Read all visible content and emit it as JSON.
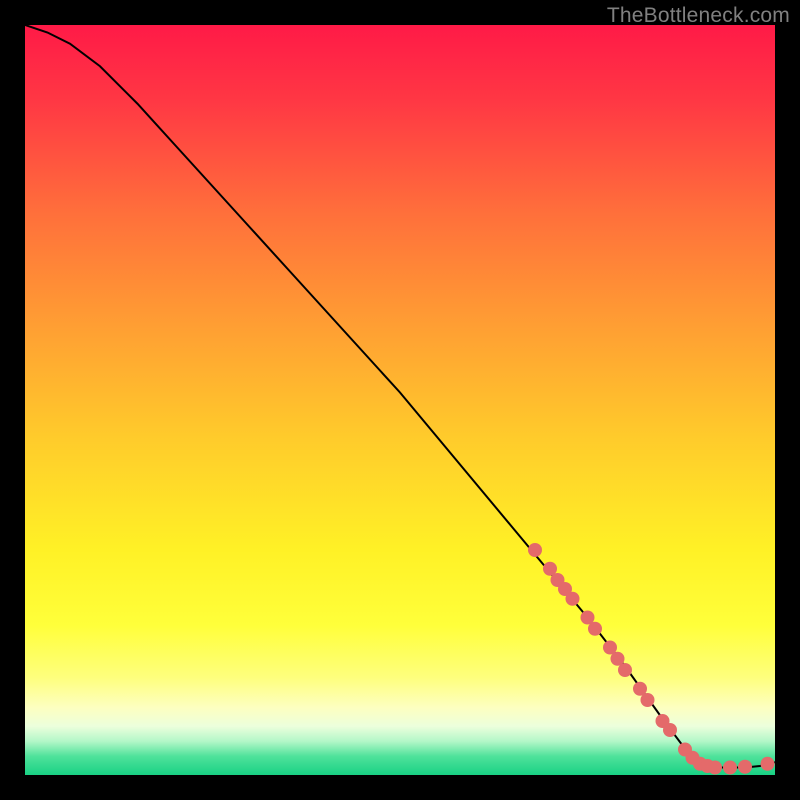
{
  "watermark": "TheBottleneck.com",
  "chart_data": {
    "type": "line",
    "title": "",
    "xlabel": "",
    "ylabel": "",
    "xlim": [
      0,
      100
    ],
    "ylim": [
      0,
      100
    ],
    "series": [
      {
        "name": "curve",
        "x": [
          0,
          3,
          6,
          10,
          15,
          20,
          25,
          30,
          35,
          40,
          45,
          50,
          55,
          60,
          65,
          70,
          75,
          80,
          85,
          88,
          90,
          92,
          94,
          96,
          98,
          100
        ],
        "y": [
          100,
          99,
          97.5,
          94.5,
          89.5,
          84,
          78.5,
          73,
          67.5,
          62,
          56.5,
          51,
          45,
          39,
          33,
          27,
          21,
          14.5,
          7.5,
          3.5,
          1.5,
          1,
          1,
          1,
          1.2,
          1.7
        ]
      }
    ],
    "scatter_points": {
      "name": "highlight-dots",
      "x": [
        68,
        70,
        71,
        72,
        73,
        75,
        76,
        78,
        79,
        80,
        82,
        83,
        85,
        86,
        88,
        89,
        90,
        91,
        92,
        94,
        96,
        99
      ],
      "y": [
        30,
        27.5,
        26,
        24.8,
        23.5,
        21,
        19.5,
        17,
        15.5,
        14,
        11.5,
        10,
        7.2,
        6,
        3.4,
        2.3,
        1.5,
        1.2,
        1,
        1,
        1.1,
        1.5
      ]
    },
    "gradient_stops": [
      {
        "offset": 0.0,
        "color": "#ff1a47"
      },
      {
        "offset": 0.1,
        "color": "#ff3744"
      },
      {
        "offset": 0.25,
        "color": "#ff6f3b"
      },
      {
        "offset": 0.4,
        "color": "#ff9e33"
      },
      {
        "offset": 0.55,
        "color": "#ffcb2b"
      },
      {
        "offset": 0.7,
        "color": "#fff126"
      },
      {
        "offset": 0.8,
        "color": "#ffff3a"
      },
      {
        "offset": 0.87,
        "color": "#feff7d"
      },
      {
        "offset": 0.91,
        "color": "#fdffc0"
      },
      {
        "offset": 0.935,
        "color": "#ecffdc"
      },
      {
        "offset": 0.955,
        "color": "#b3f7c8"
      },
      {
        "offset": 0.975,
        "color": "#4fe29b"
      },
      {
        "offset": 1.0,
        "color": "#19d184"
      }
    ],
    "dot_color": "#e46a6a",
    "line_color": "#000000"
  }
}
